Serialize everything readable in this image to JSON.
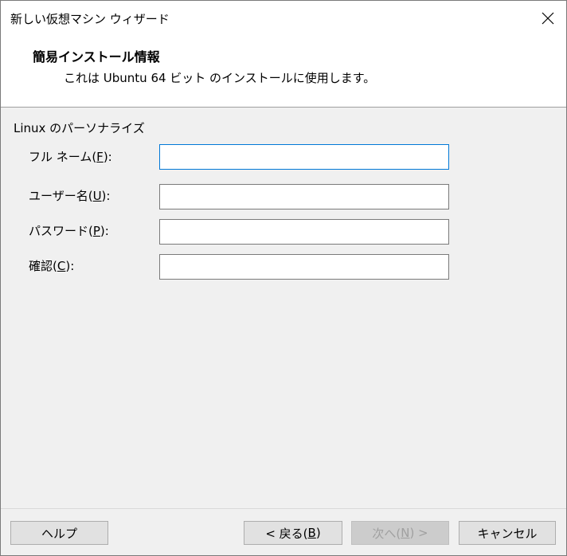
{
  "window": {
    "title": "新しい仮想マシン ウィザード",
    "close_icon": "close-icon"
  },
  "header": {
    "title": "簡易インストール情報",
    "subtitle": "これは Ubuntu 64 ビット のインストールに使用します。"
  },
  "group": {
    "label": "Linux のパーソナライズ"
  },
  "fields": {
    "fullname": {
      "label_pre": "フル ネーム(",
      "accel": "F",
      "label_post": "):",
      "value": ""
    },
    "username": {
      "label_pre": "ユーザー名(",
      "accel": "U",
      "label_post": "):",
      "value": ""
    },
    "password": {
      "label_pre": "パスワード(",
      "accel": "P",
      "label_post": "):",
      "value": ""
    },
    "confirm": {
      "label_pre": "確認(",
      "accel": "C",
      "label_post": "):",
      "value": ""
    }
  },
  "buttons": {
    "help": "ヘルプ",
    "back_pre": "< 戻る(",
    "back_accel": "B",
    "back_post": ")",
    "next_pre": "次へ(",
    "next_accel": "N",
    "next_post": ") >",
    "cancel": "キャンセル"
  },
  "colors": {
    "focus_border": "#0078d7",
    "dialog_bg": "#f0f0f0"
  }
}
